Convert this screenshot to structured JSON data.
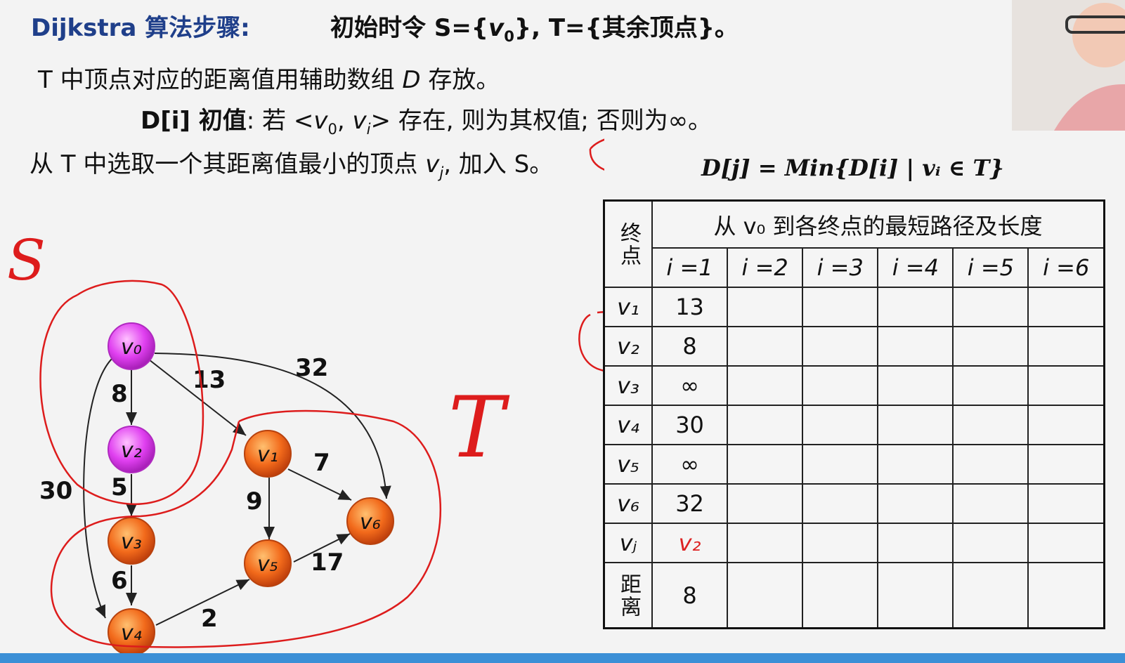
{
  "header": {
    "title": "Dijkstra 算法步骤:",
    "init_prefix": "初始时令 S={",
    "init_v": "v",
    "init_sub": "0",
    "init_suffix": "}, T={其余顶点}。"
  },
  "body": {
    "line1_a": "T 中顶点对应的距离值用辅助数组 ",
    "line1_d": "D",
    "line1_b": " 存放。",
    "line2_label": "D[i] 初值",
    "line2_a": ": 若 <",
    "line2_v0": "v",
    "line2_v0sub": "0",
    "line2_comma": ", ",
    "line2_vi": "v",
    "line2_visub": "i",
    "line2_b": "> 存在, 则为其权值; 否则为∞。",
    "line3_a": "从 T 中选取一个其距离值最小的顶点 ",
    "line3_v": "v",
    "line3_vsub": "j",
    "line3_b": ", 加入 S。",
    "formula": "D[j] = Min{D[i] | vᵢ ∈ T}",
    "formula_sub": "i"
  },
  "table": {
    "corner": "终点",
    "header": "从 v₀ 到各终点的最短路径及长度",
    "cols": [
      "i =1",
      "i =2",
      "i =3",
      "i =4",
      "i =5",
      "i =6"
    ],
    "rows": [
      {
        "label": "v₁",
        "values": [
          "13",
          "",
          "",
          "",
          "",
          ""
        ]
      },
      {
        "label": "v₂",
        "values": [
          "8",
          "",
          "",
          "",
          "",
          ""
        ]
      },
      {
        "label": "v₃",
        "values": [
          "∞",
          "",
          "",
          "",
          "",
          ""
        ]
      },
      {
        "label": "v₄",
        "values": [
          "30",
          "",
          "",
          "",
          "",
          ""
        ]
      },
      {
        "label": "v₅",
        "values": [
          "∞",
          "",
          "",
          "",
          "",
          ""
        ]
      },
      {
        "label": "v₆",
        "values": [
          "32",
          "",
          "",
          "",
          "",
          ""
        ]
      },
      {
        "label": "vⱼ",
        "values": [
          "v₂",
          "",
          "",
          "",
          "",
          ""
        ]
      }
    ],
    "dist_label": "距离",
    "dist_values": [
      "8",
      "",
      "",
      "",
      "",
      ""
    ]
  },
  "graph": {
    "nodes": [
      {
        "id": "v0",
        "label": "v₀",
        "set": "S"
      },
      {
        "id": "v2",
        "label": "v₂",
        "set": "S"
      },
      {
        "id": "v1",
        "label": "v₁",
        "set": "T"
      },
      {
        "id": "v3",
        "label": "v₃",
        "set": "T"
      },
      {
        "id": "v4",
        "label": "v₄",
        "set": "T"
      },
      {
        "id": "v5",
        "label": "v₅",
        "set": "T"
      },
      {
        "id": "v6",
        "label": "v₆",
        "set": "T"
      }
    ],
    "edges": [
      {
        "from": "v0",
        "to": "v2",
        "weight": "8"
      },
      {
        "from": "v0",
        "to": "v1",
        "weight": "13"
      },
      {
        "from": "v0",
        "to": "v6",
        "weight": "32"
      },
      {
        "from": "v0",
        "to": "v4",
        "weight": "30"
      },
      {
        "from": "v2",
        "to": "v3",
        "weight": "5"
      },
      {
        "from": "v1",
        "to": "v6",
        "weight": "7"
      },
      {
        "from": "v1",
        "to": "v5",
        "weight": "9"
      },
      {
        "from": "v3",
        "to": "v4",
        "weight": "6"
      },
      {
        "from": "v4",
        "to": "v5",
        "weight": "2"
      },
      {
        "from": "v5",
        "to": "v6",
        "weight": "17"
      }
    ],
    "annotation_S": "S",
    "annotation_T": "T"
  },
  "colors": {
    "title": "#1f3f8a",
    "s_node": "#e040f0",
    "t_node": "#f26a1b",
    "annotation": "#dd1c1c"
  }
}
